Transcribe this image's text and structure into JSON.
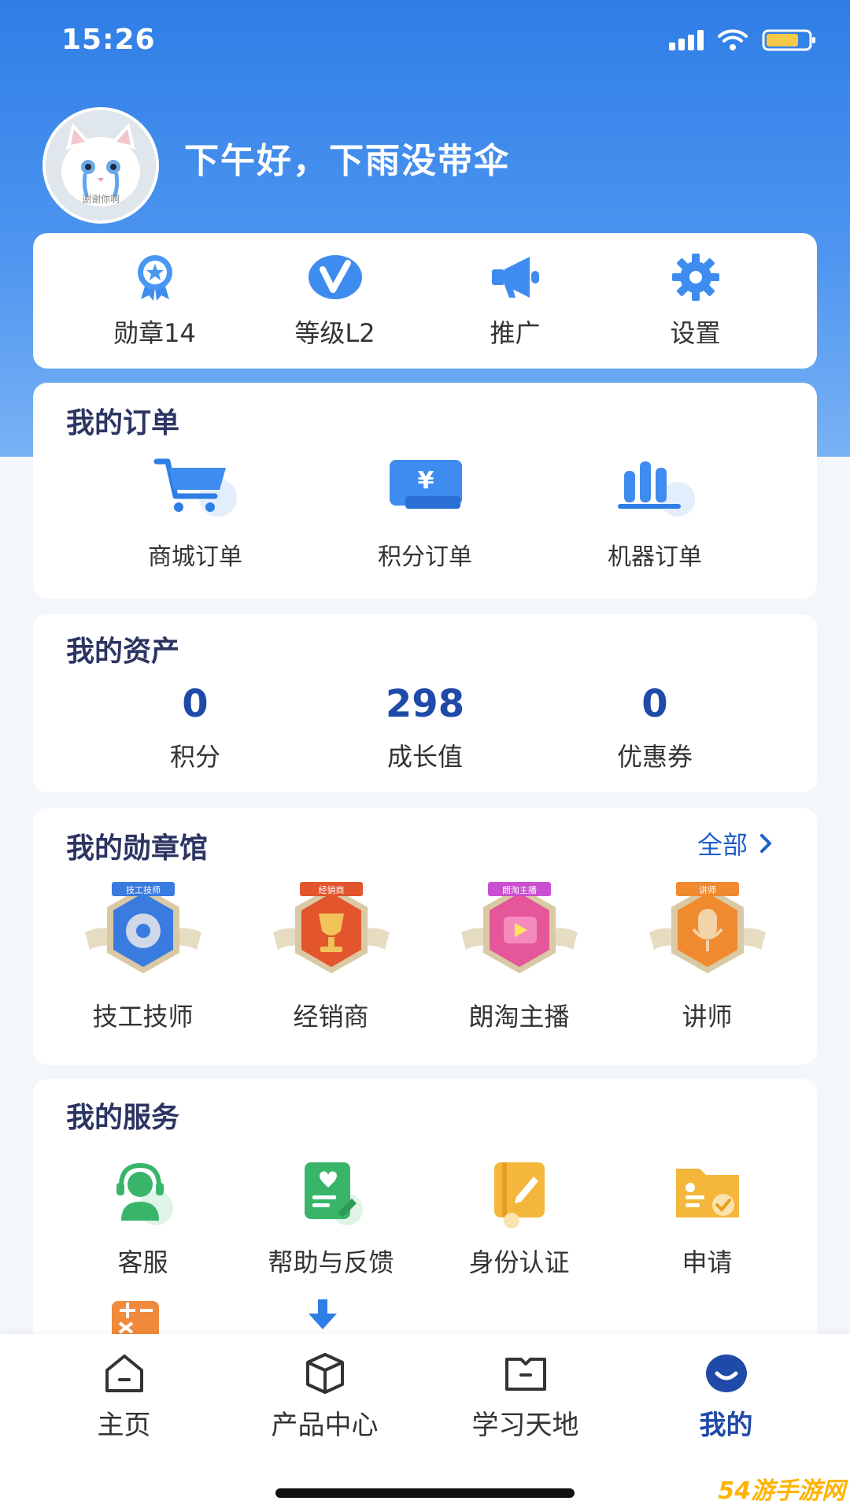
{
  "status_bar": {
    "time": "15:26"
  },
  "profile": {
    "greeting": "下午好，下雨没带伞",
    "avatar_caption": "谢谢你啊"
  },
  "quick_actions": [
    {
      "label": "勋章14",
      "icon": "medal-icon"
    },
    {
      "label": "等级L2",
      "icon": "vip-level-icon"
    },
    {
      "label": "推广",
      "icon": "megaphone-icon"
    },
    {
      "label": "设置",
      "icon": "gear-icon"
    }
  ],
  "orders": {
    "title": "我的订单",
    "items": [
      {
        "label": "商城订单",
        "icon": "cart-icon"
      },
      {
        "label": "积分订单",
        "icon": "yuan-card-icon"
      },
      {
        "label": "机器订单",
        "icon": "bars-chart-icon"
      }
    ]
  },
  "assets": {
    "title": "我的资产",
    "items": [
      {
        "value": "0",
        "label": "积分"
      },
      {
        "value": "298",
        "label": "成长值"
      },
      {
        "value": "0",
        "label": "优惠券"
      }
    ]
  },
  "medals": {
    "title": "我的勋章馆",
    "view_all": "全部",
    "items": [
      {
        "label": "技工技师",
        "ribbon": "技工技师",
        "color": "#3a7be0"
      },
      {
        "label": "经销商",
        "ribbon": "经销商",
        "color": "#e2552d"
      },
      {
        "label": "朗淘主播",
        "ribbon": "朗淘主播",
        "color": "#e6569a"
      },
      {
        "label": "讲师",
        "ribbon": "讲师",
        "color": "#ef8a2f"
      }
    ]
  },
  "services": {
    "title": "我的服务",
    "items": [
      {
        "label": "客服",
        "icon": "headset-icon"
      },
      {
        "label": "帮助与反馈",
        "icon": "feedback-icon"
      },
      {
        "label": "身份认证",
        "icon": "id-verify-icon"
      },
      {
        "label": "申请",
        "icon": "folder-apply-icon"
      }
    ],
    "more": [
      {
        "icon": "calculator-icon"
      },
      {
        "icon": "download-icon"
      }
    ]
  },
  "tab_bar": {
    "items": [
      {
        "label": "主页",
        "icon": "home-icon",
        "active": false
      },
      {
        "label": "产品中心",
        "icon": "box-icon",
        "active": false
      },
      {
        "label": "学习天地",
        "icon": "book-icon",
        "active": false
      },
      {
        "label": "我的",
        "icon": "profile-smile-icon",
        "active": true
      }
    ]
  },
  "watermark": "54游手游网",
  "colors": {
    "primary": "#2f7ee6",
    "accent_text": "#1f4aa8",
    "title": "#2c3562"
  }
}
